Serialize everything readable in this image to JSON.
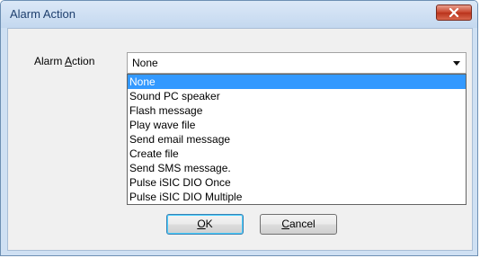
{
  "window": {
    "title": "Alarm Action"
  },
  "icons": {
    "close": "close-icon",
    "dropdown": "chevron-down-icon"
  },
  "field": {
    "label_accel": "A",
    "label_rest": "larm ",
    "label_accel2": "A",
    "label_rest2": "ction"
  },
  "combo": {
    "selected_value": "None",
    "options": [
      "None",
      "Sound PC speaker",
      "Flash message",
      "Play wave file",
      "Send email message",
      "Create file",
      "Send SMS message.",
      "Pulse iSIC DIO Once",
      "Pulse iSIC DIO Multiple"
    ]
  },
  "buttons": {
    "ok_accel": "O",
    "ok_rest": "K",
    "cancel_accel": "C",
    "cancel_rest": "ancel"
  },
  "colors": {
    "selection": "#3399ff",
    "close_button": "#c7432a"
  }
}
